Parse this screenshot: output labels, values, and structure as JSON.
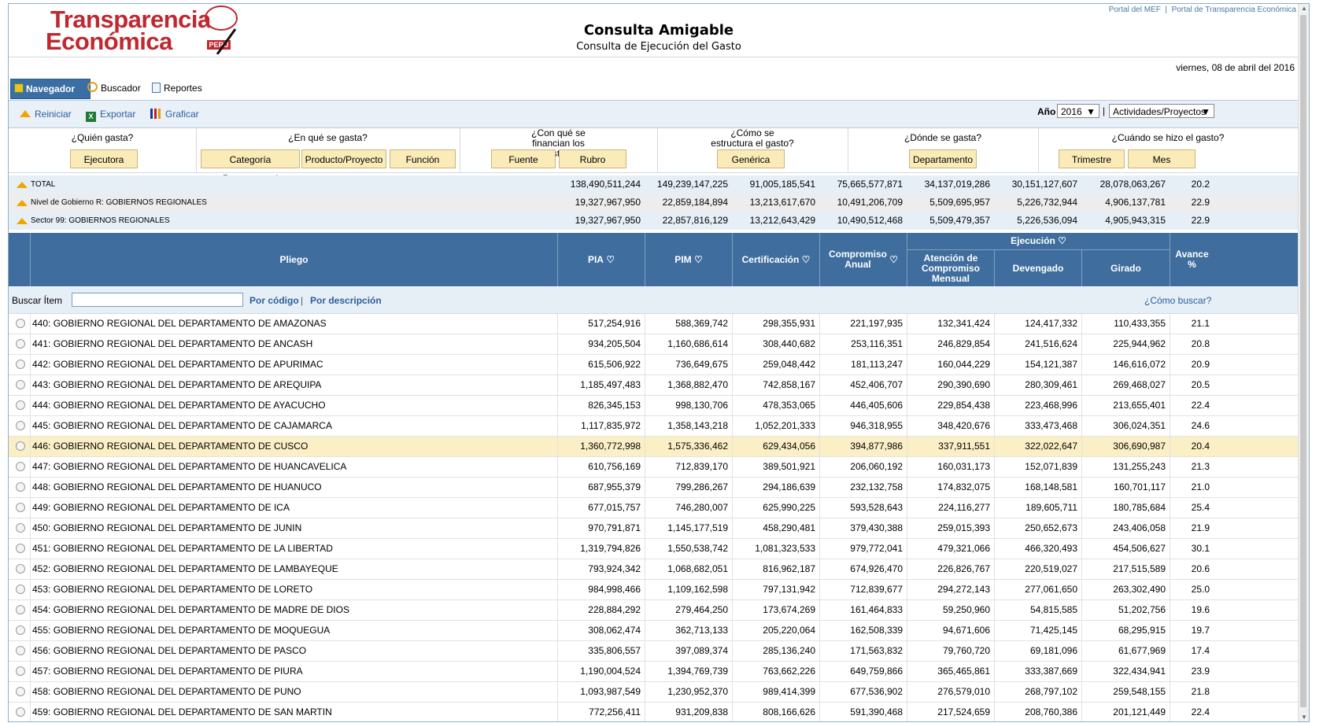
{
  "header": {
    "logo_line1": "Transparencia",
    "logo_line2": "Económica",
    "logo_sub": "PERÚ",
    "title": "Consulta Amigable",
    "subtitle": "Consulta de Ejecución del Gasto",
    "link_mef": "Portal del MEF",
    "link_sep": "|",
    "link_te": "Portal de Transparencia Económica",
    "date": "viernes, 08 de abril del 2016"
  },
  "tabs": [
    {
      "label": "Navegador",
      "icon": "cube-icon"
    },
    {
      "label": "Buscador",
      "icon": "search-icon"
    },
    {
      "label": "Reportes",
      "icon": "report-icon"
    }
  ],
  "toolbar": {
    "reiniciar": "Reiniciar",
    "exportar": "Exportar",
    "graficar": "Graficar",
    "year_label": "Año",
    "year_value": "2016",
    "mode_value": "Actividades/Proyectos"
  },
  "questions": [
    {
      "label": "¿Quién gasta?",
      "buttons": [
        "Ejecutora"
      ]
    },
    {
      "label": "¿En qué se gasta?",
      "buttons": [
        "Categoría Presupuestal",
        "Producto/Proyecto",
        "Función"
      ]
    },
    {
      "label": "¿Con qué se financian los gastos?",
      "buttons": [
        "Fuente",
        "Rubro"
      ]
    },
    {
      "label": "¿Cómo se estructura el gasto?",
      "buttons": [
        "Genérica"
      ]
    },
    {
      "label": "¿Dónde se gasta?",
      "buttons": [
        "Departamento"
      ]
    },
    {
      "label": "¿Cuándo se hizo el gasto?",
      "buttons": [
        "Trimestre",
        "Mes"
      ]
    }
  ],
  "summary": [
    {
      "label": "TOTAL",
      "values": [
        "138,490,511,244",
        "149,239,147,225",
        "91,005,185,541",
        "75,665,577,871",
        "34,137,019,286",
        "30,151,127,607",
        "28,078,063,267",
        "20.2"
      ]
    },
    {
      "label": "Nivel de Gobierno R: GOBIERNOS REGIONALES",
      "values": [
        "19,327,967,950",
        "22,859,184,894",
        "13,213,617,670",
        "10,491,206,709",
        "5,509,695,957",
        "5,226,732,944",
        "4,906,137,781",
        "22.9"
      ]
    },
    {
      "label": "Sector 99: GOBIERNOS REGIONALES",
      "values": [
        "19,327,967,950",
        "22,857,816,129",
        "13,212,643,429",
        "10,490,512,468",
        "5,509,479,357",
        "5,226,536,094",
        "4,905,943,315",
        "22.9"
      ]
    }
  ],
  "table_header": {
    "pliego": "Pliego",
    "pia": "PIA",
    "pim": "PIM",
    "certificacion": "Certificación",
    "compromiso": "Compromiso Anual",
    "ejecucion": "Ejecución",
    "atencion": "Atención de Compromiso Mensual",
    "devengado": "Devengado",
    "girado": "Girado",
    "avance": "Avance %"
  },
  "search": {
    "label": "Buscar Ítem",
    "value": "",
    "by_code": "Por código",
    "sep": "|",
    "by_desc": "Por descripción",
    "help": "¿Cómo buscar?"
  },
  "rows": [
    {
      "name": "440: GOBIERNO REGIONAL DEL DEPARTAMENTO DE AMAZONAS",
      "values": [
        "517,254,916",
        "588,369,742",
        "298,355,931",
        "221,197,935",
        "132,341,424",
        "124,417,332",
        "110,433,355",
        "21.1"
      ]
    },
    {
      "name": "441: GOBIERNO REGIONAL DEL DEPARTAMENTO DE ANCASH",
      "values": [
        "934,205,504",
        "1,160,686,614",
        "308,440,682",
        "253,116,351",
        "246,829,854",
        "241,516,624",
        "225,944,962",
        "20.8"
      ]
    },
    {
      "name": "442: GOBIERNO REGIONAL DEL DEPARTAMENTO DE APURIMAC",
      "values": [
        "615,506,922",
        "736,649,675",
        "259,048,442",
        "181,113,247",
        "160,044,229",
        "154,121,387",
        "146,616,072",
        "20.9"
      ]
    },
    {
      "name": "443: GOBIERNO REGIONAL DEL DEPARTAMENTO DE AREQUIPA",
      "values": [
        "1,185,497,483",
        "1,368,882,470",
        "742,858,167",
        "452,406,707",
        "290,390,690",
        "280,309,461",
        "269,468,027",
        "20.5"
      ]
    },
    {
      "name": "444: GOBIERNO REGIONAL DEL DEPARTAMENTO DE AYACUCHO",
      "values": [
        "826,345,153",
        "998,130,706",
        "478,353,065",
        "446,405,606",
        "229,854,438",
        "223,468,996",
        "213,655,401",
        "22.4"
      ]
    },
    {
      "name": "445: GOBIERNO REGIONAL DEL DEPARTAMENTO DE CAJAMARCA",
      "values": [
        "1,117,835,972",
        "1,358,143,218",
        "1,052,201,333",
        "946,318,955",
        "348,420,676",
        "333,473,468",
        "306,024,351",
        "24.6"
      ]
    },
    {
      "name": "446: GOBIERNO REGIONAL DEL DEPARTAMENTO DE CUSCO",
      "values": [
        "1,360,772,998",
        "1,575,336,462",
        "629,434,056",
        "394,877,986",
        "337,911,551",
        "322,022,647",
        "306,690,987",
        "20.4"
      ],
      "highlight": true
    },
    {
      "name": "447: GOBIERNO REGIONAL DEL DEPARTAMENTO DE HUANCAVELICA",
      "values": [
        "610,756,169",
        "712,839,170",
        "389,501,921",
        "206,060,192",
        "160,031,173",
        "152,071,839",
        "131,255,243",
        "21.3"
      ]
    },
    {
      "name": "448: GOBIERNO REGIONAL DEL DEPARTAMENTO DE HUANUCO",
      "values": [
        "687,955,379",
        "799,286,267",
        "294,186,639",
        "232,132,758",
        "174,832,075",
        "168,148,581",
        "160,701,117",
        "21.0"
      ]
    },
    {
      "name": "449: GOBIERNO REGIONAL DEL DEPARTAMENTO DE ICA",
      "values": [
        "677,015,757",
        "746,280,007",
        "625,990,225",
        "593,528,643",
        "224,116,277",
        "189,605,711",
        "180,785,684",
        "25.4"
      ]
    },
    {
      "name": "450: GOBIERNO REGIONAL DEL DEPARTAMENTO DE JUNIN",
      "values": [
        "970,791,871",
        "1,145,177,519",
        "458,290,481",
        "379,430,388",
        "259,015,393",
        "250,652,673",
        "243,406,058",
        "21.9"
      ]
    },
    {
      "name": "451: GOBIERNO REGIONAL DEL DEPARTAMENTO DE LA LIBERTAD",
      "values": [
        "1,319,794,826",
        "1,550,538,742",
        "1,081,323,533",
        "979,772,041",
        "479,321,066",
        "466,320,493",
        "454,506,627",
        "30.1"
      ]
    },
    {
      "name": "452: GOBIERNO REGIONAL DEL DEPARTAMENTO DE LAMBAYEQUE",
      "values": [
        "793,924,342",
        "1,068,682,051",
        "816,962,187",
        "674,926,470",
        "226,826,767",
        "220,519,027",
        "217,515,589",
        "20.6"
      ]
    },
    {
      "name": "453: GOBIERNO REGIONAL DEL DEPARTAMENTO DE LORETO",
      "values": [
        "984,998,466",
        "1,109,162,598",
        "797,131,942",
        "712,839,677",
        "294,272,143",
        "277,061,650",
        "263,302,490",
        "25.0"
      ]
    },
    {
      "name": "454: GOBIERNO REGIONAL DEL DEPARTAMENTO DE MADRE DE DIOS",
      "values": [
        "228,884,292",
        "279,464,250",
        "173,674,269",
        "161,464,833",
        "59,250,960",
        "54,815,585",
        "51,202,756",
        "19.6"
      ]
    },
    {
      "name": "455: GOBIERNO REGIONAL DEL DEPARTAMENTO DE MOQUEGUA",
      "values": [
        "308,062,474",
        "362,713,133",
        "205,220,064",
        "162,508,339",
        "94,671,606",
        "71,425,145",
        "68,295,915",
        "19.7"
      ]
    },
    {
      "name": "456: GOBIERNO REGIONAL DEL DEPARTAMENTO DE PASCO",
      "values": [
        "335,806,557",
        "397,089,374",
        "285,136,240",
        "171,563,832",
        "79,760,720",
        "69,181,096",
        "61,677,969",
        "17.4"
      ]
    },
    {
      "name": "457: GOBIERNO REGIONAL DEL DEPARTAMENTO DE PIURA",
      "values": [
        "1,190,004,524",
        "1,394,769,739",
        "763,662,226",
        "649,759,866",
        "365,465,861",
        "333,387,669",
        "322,434,941",
        "23.9"
      ]
    },
    {
      "name": "458: GOBIERNO REGIONAL DEL DEPARTAMENTO DE PUNO",
      "values": [
        "1,093,987,549",
        "1,230,952,370",
        "989,414,399",
        "677,536,902",
        "276,579,010",
        "268,797,102",
        "259,548,155",
        "21.8"
      ]
    },
    {
      "name": "459: GOBIERNO REGIONAL DEL DEPARTAMENTO DE SAN MARTIN",
      "values": [
        "772,256,411",
        "931,209,838",
        "808,166,626",
        "591,390,468",
        "217,524,659",
        "208,760,386",
        "201,121,449",
        "22.4"
      ]
    }
  ]
}
